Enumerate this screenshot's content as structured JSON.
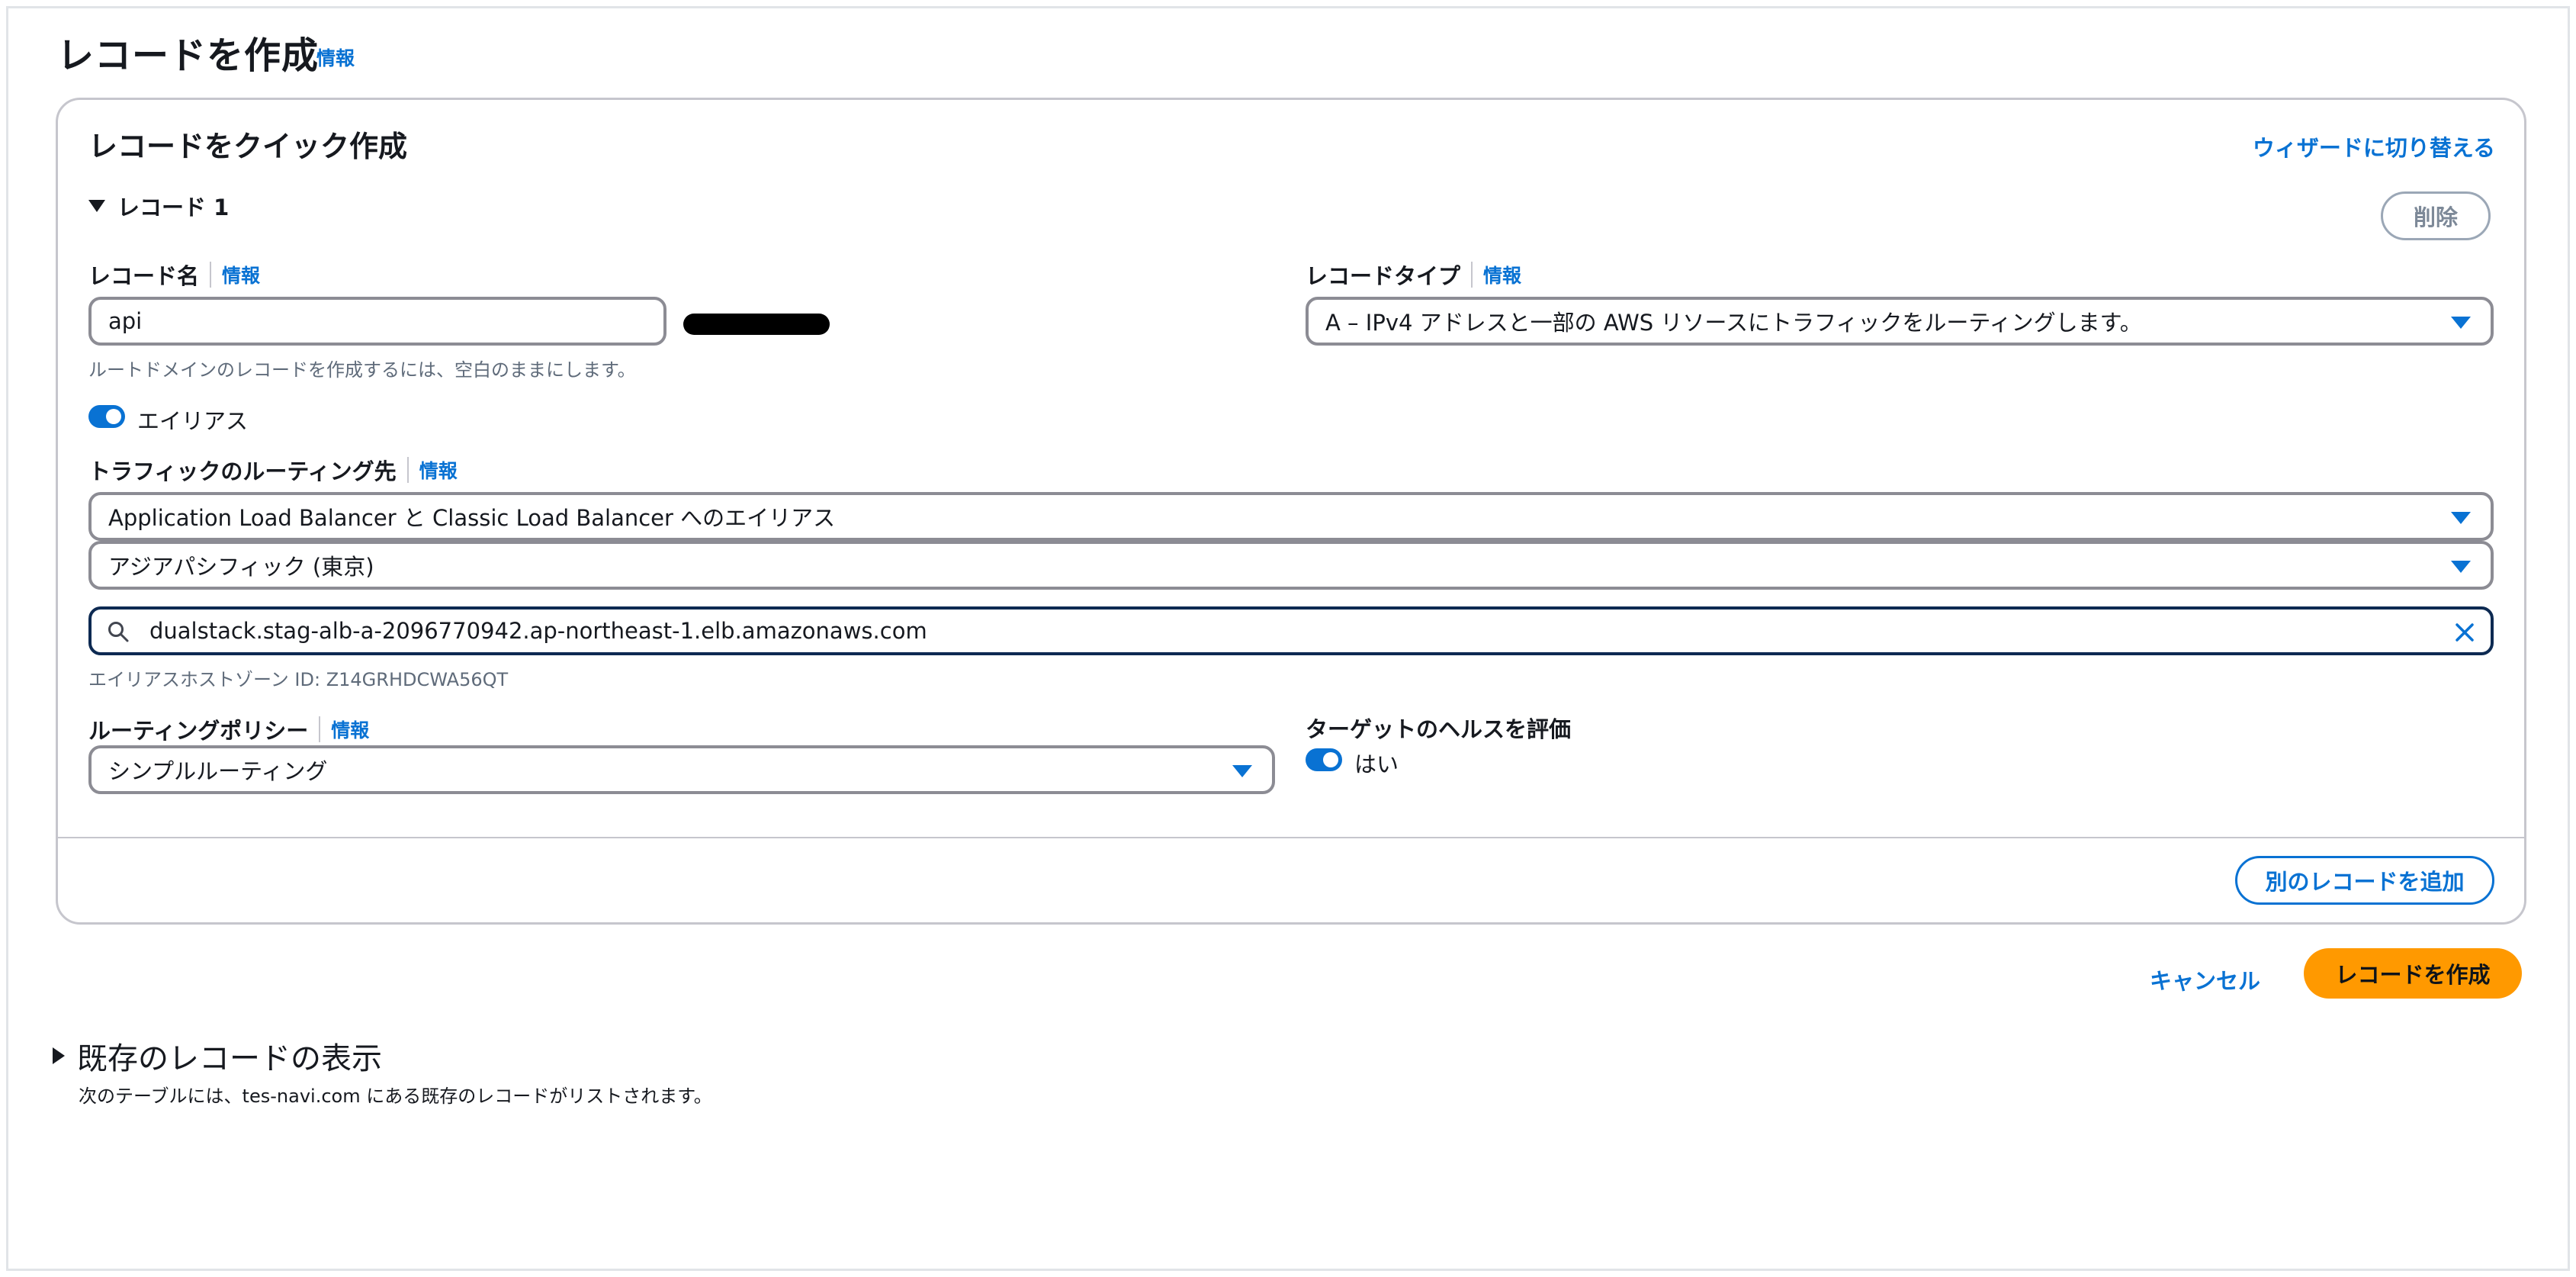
{
  "page": {
    "title": "レコードを作成",
    "info": "情報"
  },
  "card": {
    "title": "レコードをクイック作成",
    "switch_wizard": "ウィザードに切り替える",
    "record_section_label": "レコード 1",
    "delete_label": "削除",
    "record_name": {
      "label": "レコード名",
      "info": "情報",
      "value": "api",
      "hint": "ルートドメインのレコードを作成するには、空白のままにします。"
    },
    "record_type": {
      "label": "レコードタイプ",
      "info": "情報",
      "value": "A – IPv4 アドレスと一部の AWS リソースにトラフィックをルーティングします。"
    },
    "alias": {
      "enabled": true,
      "label": "エイリアス"
    },
    "route_traffic": {
      "label": "トラフィックのルーティング先",
      "info": "情報",
      "endpoint_value": "Application Load Balancer と Classic Load Balancer へのエイリアス",
      "region_value": "アジアパシフィック (東京)",
      "search_value": "dualstack.stag-alb-a-2096770942.ap-northeast-1.elb.amazonaws.com",
      "hosted_zone_hint": "エイリアスホストゾーン ID: Z14GRHDCWA56QT"
    },
    "routing_policy": {
      "label": "ルーティングポリシー",
      "info": "情報",
      "value": "シンプルルーティング"
    },
    "health": {
      "label": "ターゲットのヘルスを評価",
      "enabled": true,
      "value_label": "はい"
    },
    "add_record_label": "別のレコードを追加"
  },
  "actions": {
    "cancel": "キャンセル",
    "create": "レコードを作成"
  },
  "existing": {
    "title": "既存のレコードの表示",
    "description": "次のテーブルには、tes-navi.com にある既存のレコードがリストされます。"
  },
  "colors": {
    "link": "#0972d3",
    "primary": "#ff9900",
    "border": "#8c8c94"
  }
}
